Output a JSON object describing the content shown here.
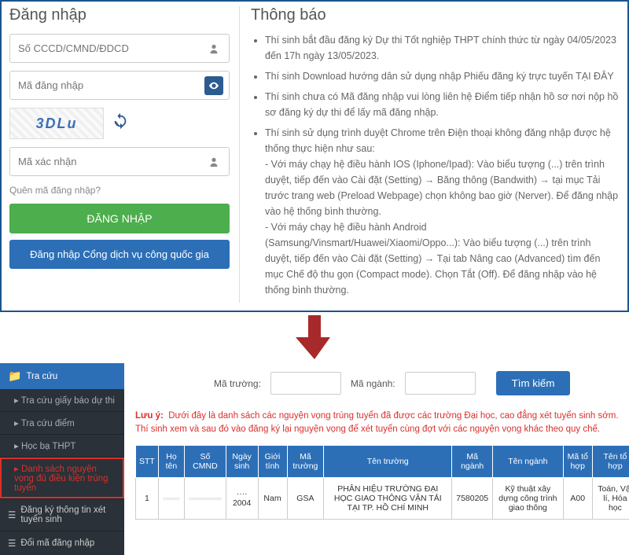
{
  "login": {
    "title": "Đăng nhập",
    "id_placeholder": "Số CCCD/CMND/ĐDCD",
    "code_placeholder": "Mã đăng nhập",
    "captcha_text": "3DLu",
    "captcha_placeholder": "Mã xác nhận",
    "forgot": "Quên mã đăng nhập?",
    "btn_login": "ĐĂNG NHẬP",
    "btn_gov": "Đăng nhập Cổng dịch vụ công quốc gia"
  },
  "notice": {
    "title": "Thông báo",
    "items": [
      "Thí sinh bắt đầu đăng ký Dự thi Tốt nghiệp THPT chính thức từ ngày 04/05/2023 đến 17h ngày 13/05/2023.",
      "Thí sinh Download hướng dân sử dụng nhập Phiếu đăng ký trực tuyến TẠI ĐÂY",
      "Thí sinh chưa có Mã đăng nhập vui lòng liên hệ Điểm tiếp nhận hồ sơ nơi nộp hồ sơ đăng ký dự thi để lấy mã đăng nhập.",
      "Thí sinh sử dụng trình duyệt Chrome trên Điện thoại không đăng nhập được hệ thống thực hiện như sau:"
    ],
    "ios_line": " - Với máy chạy hệ điều hành IOS (Iphone/Ipad): Vào biểu tượng (...) trên trình duyệt, tiếp đến vào Cài đặt (Setting) → Băng thông (Bandwith) → tại mục Tải trước trang web (Preload Webpage) chọn không bao giờ (Nerver). Để đăng nhập vào hệ thống bình thường.",
    "android_line": " - Với máy chạy hệ điều hành Android (Samsung/Vinsmart/Huawei/Xiaomi/Oppo...): Vào biểu tượng (...) trên trình duyệt, tiếp đến vào Cài đặt (Setting) → Tại tab Nâng cao (Advanced) tìm đến mục Chế độ thu gọn (Compact mode). Chọn Tắt (Off). Để đăng nhập vào hệ thống bình thường."
  },
  "sidebar": {
    "head": "Tra cứu",
    "items": [
      "Tra cứu giấy báo dự thi",
      "Tra cứu điểm",
      "Học bạ THPT",
      "Danh sách nguyện vọng đủ điều kiện trúng tuyển"
    ],
    "root1": "Đăng ký thông tin xét tuyển sinh",
    "root2": "Đổi mã đăng nhập"
  },
  "search": {
    "school_label": "Mã trường:",
    "major_label": "Mã ngành:",
    "btn": "Tìm kiếm"
  },
  "note": {
    "label": "Lưu ý:",
    "text": "Dưới đây là danh sách các nguyện vọng trúng tuyển đã được các trường Đại học, cao đẳng xét tuyển sinh sớm. Thí sinh xem và sau đó vào đăng ký lại nguyện vọng để xét tuyển cùng đợt với các nguyện vọng khác theo quy chế."
  },
  "table": {
    "headers": [
      "STT",
      "Họ tên",
      "Số CMND",
      "Ngày sinh",
      "Giới tính",
      "Mã trường",
      "Tên trường",
      "Mã ngành",
      "Tên ngành",
      "Mã tổ hợp",
      "Tên tổ hợp"
    ],
    "row": {
      "stt": "1",
      "hoten": "······",
      "cmnd": "············",
      "ngaysinh": "···· 2004",
      "gioitinh": "Nam",
      "matruong": "GSA",
      "tentruong": "PHÂN HIỆU TRƯỜNG ĐẠI HỌC GIAO THÔNG VẬN TẢI TẠI TP. HỒ CHÍ MINH",
      "manganh": "7580205",
      "tennganh": "Kỹ thuật xây dựng công trình giao thông",
      "matohop": "A00",
      "tentohop": "Toán, Vật lí, Hóa học"
    }
  }
}
